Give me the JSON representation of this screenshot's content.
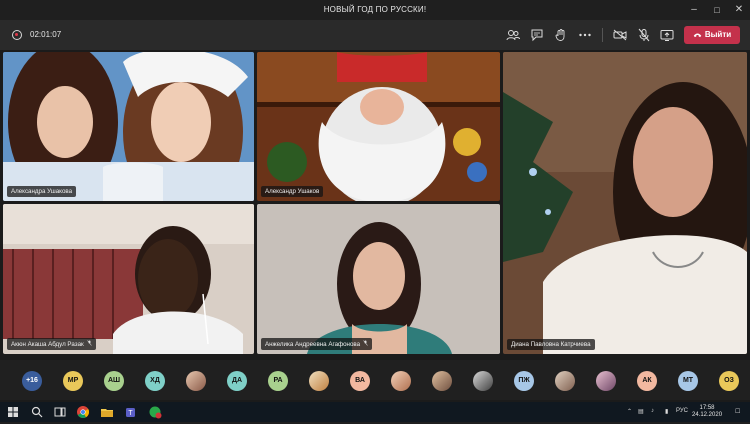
{
  "window": {
    "title": "НОВЫЙ ГОД ПО РУССКИ!"
  },
  "toolbar": {
    "timer": "02:01:07",
    "leave_label": "Выйти"
  },
  "participants": {
    "tile1": "Александра Ушакова",
    "tile2": "Александр Ушаков",
    "tile4": "Акюн Акаша Абдул Разак",
    "tile5": "Анжелика Андреевна Агафонова",
    "tile6": "Диана Павловна Катрчиева"
  },
  "strip": {
    "overflow": "+16",
    "initials": [
      "МР",
      "АШ",
      "ХД",
      "ДА",
      "РА",
      "ВА",
      "ПЖ",
      "АК",
      "МТ",
      "ОЗ"
    ]
  },
  "taskbar": {
    "lang": "РУС",
    "time": "17:58",
    "date": "24.12.2020"
  },
  "colors": {
    "leave": "#c4314b",
    "avatar_yellow": "#e9c85a",
    "avatar_teal": "#7fd0c8",
    "avatar_green": "#a9d18e",
    "avatar_blue": "#a7c7e7",
    "avatar_peach": "#f2b8a0",
    "avatar_purple": "#b8a9e0"
  }
}
